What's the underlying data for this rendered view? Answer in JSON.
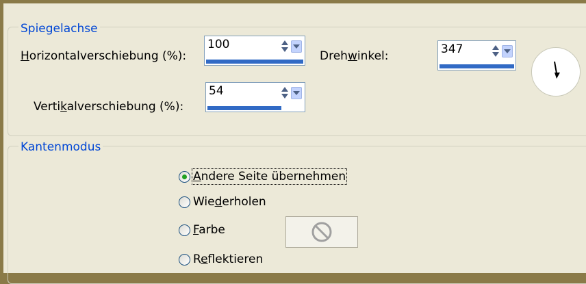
{
  "mirror_axis": {
    "title": "Spiegelachse",
    "horizontal": {
      "label_mnemonic": "H",
      "label_rest": "orizontalverschiebung (%):",
      "value": "100",
      "fill": 1.0
    },
    "vertical": {
      "label_pre": "Verti",
      "label_mnemonic": "k",
      "label_rest": "alverschiebung (%):",
      "value": "54",
      "fill": 0.77
    },
    "rotation": {
      "label_pre": "Dreh",
      "label_mnemonic": "w",
      "label_rest": "inkel:",
      "value": "347",
      "fill": 1.0
    }
  },
  "edge_mode": {
    "title": "Kantenmodus",
    "options": [
      {
        "pre": "",
        "mnemonic": "A",
        "rest": "ndere Seite übernehmen",
        "selected": true
      },
      {
        "pre": "Wie",
        "mnemonic": "d",
        "rest": "erholen",
        "selected": false
      },
      {
        "pre": "",
        "mnemonic": "F",
        "rest": "arbe",
        "selected": false
      },
      {
        "pre": "R",
        "mnemonic": "e",
        "rest": "flektieren",
        "selected": false
      }
    ]
  },
  "icons": {
    "spin_arrows": "up-down-arrow-icon",
    "dropdown": "chevron-down-icon",
    "color_disabled": "prohibited-icon",
    "dial_pointer": "dial-pointer-icon"
  },
  "colors": {
    "group_title": "#0046d5",
    "background": "#ece9d8",
    "accent_bar": "#316ac5"
  }
}
